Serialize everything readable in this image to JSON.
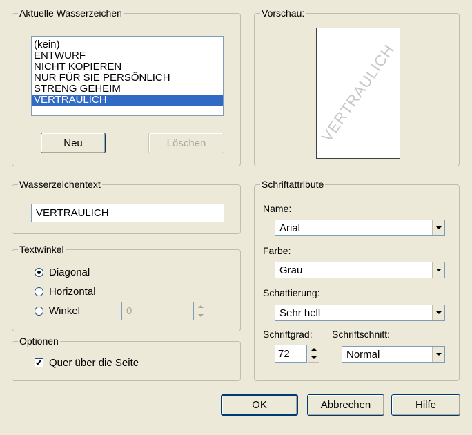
{
  "watermarks": {
    "legend": "Aktuelle Wasserzeichen",
    "items": [
      "(kein)",
      "ENTWURF",
      "NICHT KOPIEREN",
      "NUR FÜR SIE PERSÖNLICH",
      "STRENG GEHEIM",
      "VERTRAULICH"
    ],
    "selected_index": 5,
    "new_label": "Neu",
    "delete_label": "Löschen"
  },
  "preview": {
    "legend": "Vorschau:",
    "watermark_text": "VERTRAULICH"
  },
  "watermark_text": {
    "legend": "Wasserzeichentext",
    "value": "VERTRAULICH"
  },
  "angle": {
    "legend": "Textwinkel",
    "diagonal": "Diagonal",
    "horizontal": "Horizontal",
    "winkel": "Winkel",
    "winkel_value": "0",
    "selected": "diagonal"
  },
  "options": {
    "legend": "Optionen",
    "across_page": "Quer über die Seite",
    "across_page_checked": true
  },
  "font": {
    "legend": "Schriftattribute",
    "name_label": "Name:",
    "name_value": "Arial",
    "color_label": "Farbe:",
    "color_value": "Grau",
    "shading_label": "Schattierung:",
    "shading_value": "Sehr hell",
    "size_label": "Schriftgrad:",
    "size_value": "72",
    "style_label": "Schriftschnitt:",
    "style_value": "Normal"
  },
  "buttons": {
    "ok": "OK",
    "cancel": "Abbrechen",
    "help": "Hilfe"
  }
}
